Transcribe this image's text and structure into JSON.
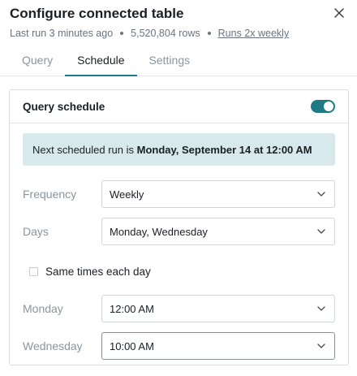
{
  "header": {
    "title": "Configure connected table",
    "last_run": "Last run 3 minutes ago",
    "rows": "5,520,804 rows",
    "runs": "Runs 2x weekly"
  },
  "tabs": [
    {
      "label": "Query",
      "active": false
    },
    {
      "label": "Schedule",
      "active": true
    },
    {
      "label": "Settings",
      "active": false
    }
  ],
  "schedule": {
    "title": "Query schedule",
    "enabled": true,
    "banner_prefix": "Next scheduled run is ",
    "banner_value": "Monday, September 14 at 12:00 AM",
    "frequency": {
      "label": "Frequency",
      "value": "Weekly"
    },
    "days": {
      "label": "Days",
      "value": "Monday, Wednesday"
    },
    "same_times": {
      "label": "Same times each day",
      "checked": false
    },
    "monday": {
      "label": "Monday",
      "value": "12:00 AM"
    },
    "wednesday": {
      "label": "Wednesday",
      "value": "10:00 AM"
    }
  },
  "colors": {
    "accent": "#1f7a87",
    "banner_bg": "#d7e9ed"
  },
  "icons": {
    "close": "close-icon",
    "dropdown": "chevron-down-icon"
  }
}
